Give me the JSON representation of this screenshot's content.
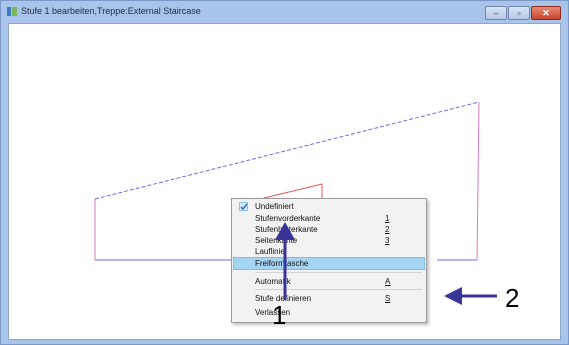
{
  "window": {
    "title": "Stufe 1 bearbeiten,Treppe:External Staircase",
    "controls": {
      "minimize": "–",
      "maximize": "▫",
      "close": "✕"
    }
  },
  "colors": {
    "title_bar": "#a9c4ea",
    "outline_blue": "#6e6ee6",
    "outline_red": "#e05a5a",
    "outline_magenta": "#d87ab8",
    "arrow": "#3a3499",
    "menu_highlight": "#a4d4f2"
  },
  "context_menu": {
    "items": [
      {
        "label": "Undefiniert",
        "shortcut": "",
        "checked": true
      },
      {
        "label": "Stufenvorderkante",
        "shortcut": "1"
      },
      {
        "label": "Stufenhinterkante",
        "shortcut": "2"
      },
      {
        "label": "Seitenkante",
        "shortcut": "3"
      },
      {
        "label": "Lauflinie",
        "shortcut": ""
      },
      {
        "label": "Freiformtasche",
        "shortcut": "",
        "highlighted": true
      },
      {
        "label": "Automatik",
        "shortcut": "A"
      },
      {
        "label": "Stufe definieren",
        "shortcut": "S"
      },
      {
        "label": "Verlassen",
        "shortcut": ""
      }
    ]
  },
  "callouts": {
    "one": "1",
    "two": "2"
  }
}
